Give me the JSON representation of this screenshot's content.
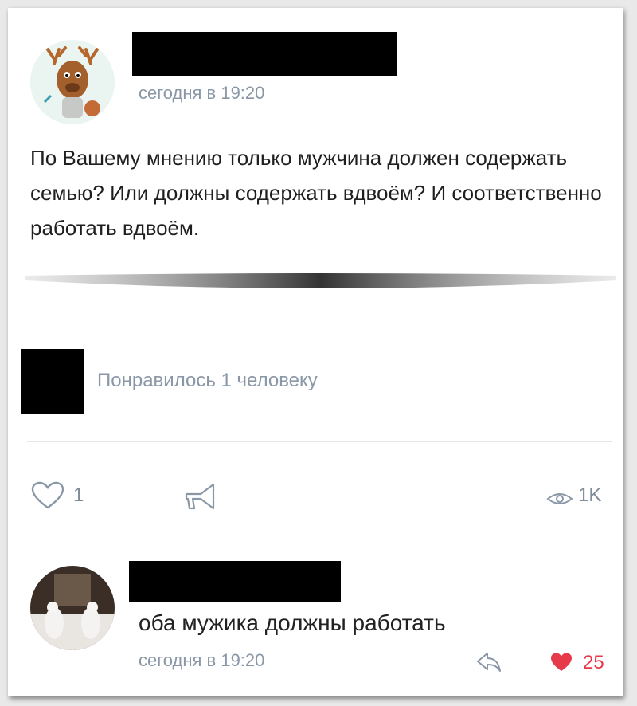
{
  "post": {
    "time": "сегодня в 19:20",
    "text": "По Вашему мнению только мужчина должен содержать семью? Или должны содержать вдвоём? И соответственно работать вдвоём."
  },
  "likes_summary": {
    "text": "Понравилось 1 человеку"
  },
  "actions": {
    "like_count": "1",
    "views": "1K"
  },
  "comment": {
    "text": "оба мужика должны работать",
    "time": "сегодня в 19:20",
    "likes": "25",
    "like_color": "#e6394a"
  },
  "icons": [
    "moose-avatar",
    "heart-icon",
    "share-icon",
    "eye-icon",
    "reply-icon",
    "heart-filled-icon",
    "comment-avatar"
  ]
}
